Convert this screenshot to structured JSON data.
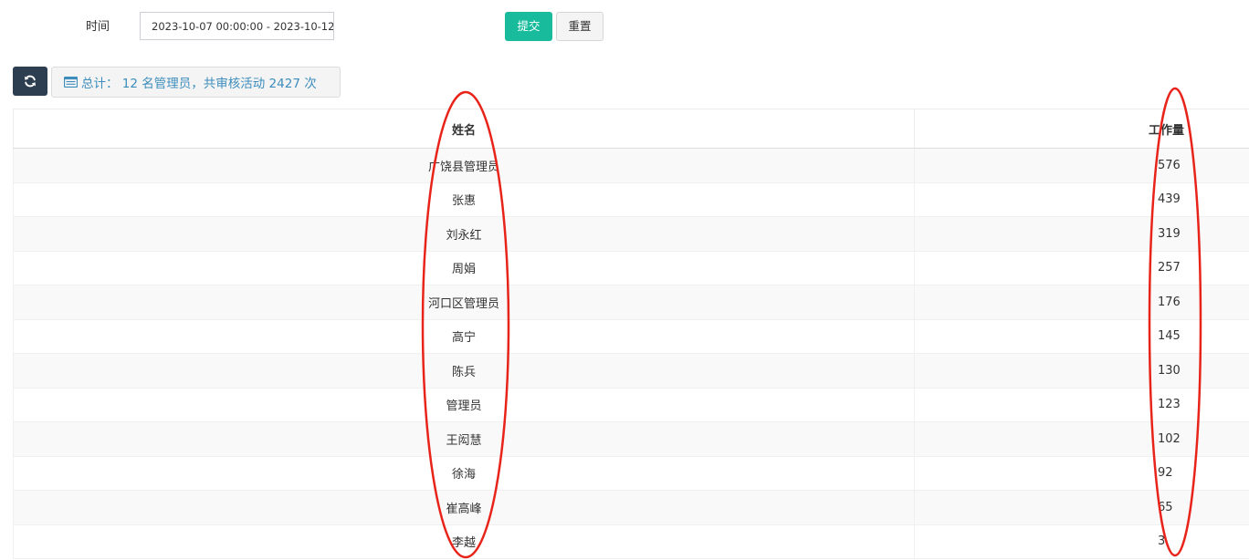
{
  "filter": {
    "time_label": "时间",
    "date_range_value": "2023-10-07 00:00:00 - 2023-10-12",
    "submit_label": "提交",
    "reset_label": "重置"
  },
  "toolbar": {
    "refresh_icon": "refresh-icon",
    "summary_icon": "list-icon",
    "summary_text": "总计： 12 名管理员，共审核活动 2427 次"
  },
  "table": {
    "headers": [
      "姓名",
      "工作量"
    ],
    "rows": [
      {
        "name": "广饶县管理员",
        "count": "576"
      },
      {
        "name": "张惠",
        "count": "439"
      },
      {
        "name": "刘永红",
        "count": "319"
      },
      {
        "name": "周娟",
        "count": "257"
      },
      {
        "name": "河口区管理员",
        "count": "176"
      },
      {
        "name": "高宁",
        "count": "145"
      },
      {
        "name": "陈兵",
        "count": "130"
      },
      {
        "name": "管理员",
        "count": "123"
      },
      {
        "name": "王闳慧",
        "count": "102"
      },
      {
        "name": "徐海",
        "count": "92"
      },
      {
        "name": "崔高峰",
        "count": "65"
      },
      {
        "name": "李越",
        "count": "3"
      }
    ]
  },
  "colors": {
    "submit": "#18bc9c",
    "refresh": "#2c3e50",
    "summary_text": "#3c8dbc",
    "annotation": "#e8241a"
  }
}
